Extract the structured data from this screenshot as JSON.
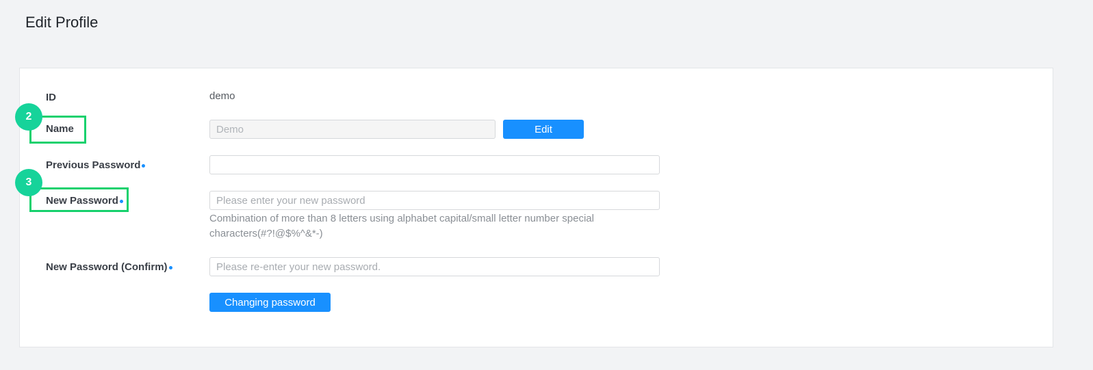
{
  "header": {
    "title": "Edit Profile"
  },
  "form": {
    "id": {
      "label": "ID",
      "value": "demo"
    },
    "name": {
      "label": "Name",
      "value": "Demo",
      "edit_button": "Edit"
    },
    "previous_password": {
      "label": "Previous Password",
      "value": ""
    },
    "new_password": {
      "label": "New Password",
      "placeholder": "Please enter your new password",
      "hint": "Combination of more than 8 letters using alphabet capital/small letter number special characters(#?!@$%^&*-)"
    },
    "confirm_password": {
      "label": "New Password (Confirm)",
      "placeholder": "Please re-enter your new password."
    },
    "submit_button": "Changing password"
  },
  "annotations": [
    {
      "number": "2",
      "target": "Name"
    },
    {
      "number": "3",
      "target": "New Password"
    }
  ],
  "colors": {
    "accent": "#1890ff",
    "highlight": "#16d16d",
    "badge": "#16d39a"
  }
}
